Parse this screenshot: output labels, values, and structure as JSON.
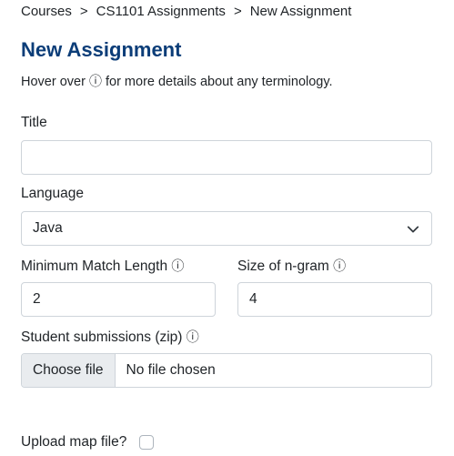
{
  "breadcrumb": {
    "items": [
      "Courses",
      "CS1101 Assignments",
      "New Assignment"
    ],
    "separator": ">"
  },
  "page": {
    "title": "New Assignment",
    "hint_before": "Hover over ",
    "hint_icon": "ⓘ",
    "hint_after": " for more details about any terminology."
  },
  "form": {
    "title_label": "Title",
    "title_value": "",
    "language_label": "Language",
    "language_value": "Java",
    "min_match_label": "Minimum Match Length",
    "min_match_value": "2",
    "ngram_label": "Size of n-gram",
    "ngram_value": "4",
    "submissions_label": "Student submissions (zip)",
    "choose_file_label": "Choose file",
    "file_status": "No file chosen",
    "upload_map_label": "Upload map file?",
    "upload_map_checked": false,
    "info_icon": "ⓘ"
  },
  "icons": {
    "info": "info-icon",
    "select_arrow": "chevron-down-icon"
  },
  "colors": {
    "title": "#0b3d78",
    "text": "#212529",
    "border": "#ced4da",
    "file_button_bg": "#e9ecef"
  }
}
